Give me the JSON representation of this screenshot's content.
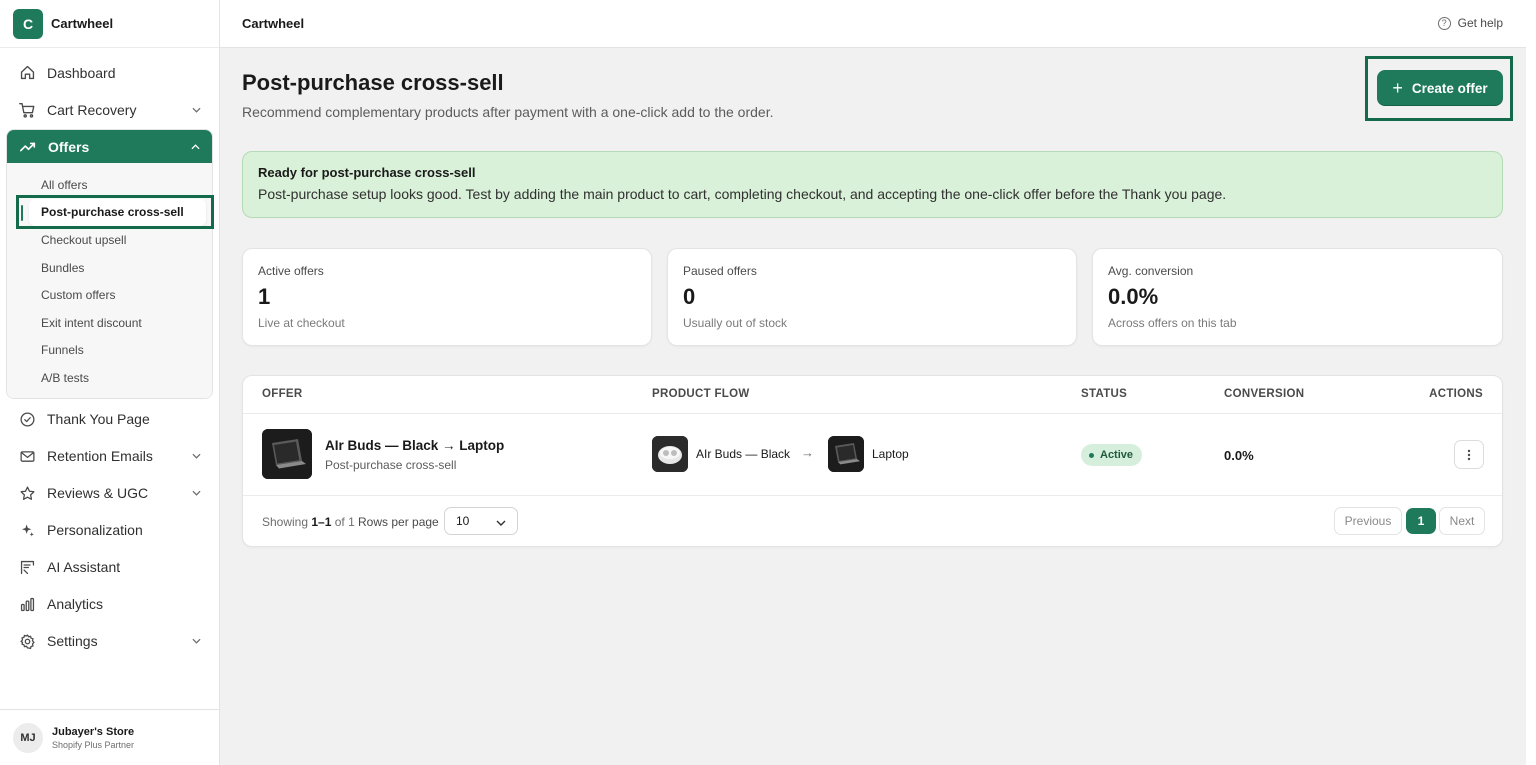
{
  "brand": {
    "logo_letter": "C",
    "name": "Cartwheel",
    "accent": "#1f7a5c"
  },
  "sidebar": {
    "items_top": [
      {
        "label": "Dashboard",
        "icon": "home-icon"
      },
      {
        "label": "Cart Recovery",
        "icon": "cart-icon",
        "chevron": true
      }
    ],
    "offers": {
      "label": "Offers",
      "icon": "trend-icon",
      "sub": [
        "All offers",
        "Post-purchase cross-sell",
        "Checkout upsell",
        "Bundles",
        "Custom offers",
        "Exit intent discount",
        "Funnels",
        "A/B tests"
      ],
      "current_index": 1
    },
    "items_bottom": [
      {
        "label": "Thank You Page",
        "icon": "check-circle-icon"
      },
      {
        "label": "Retention Emails",
        "icon": "mail-icon",
        "chevron": true
      },
      {
        "label": "Reviews & UGC",
        "icon": "star-icon",
        "chevron": true
      },
      {
        "label": "Personalization",
        "icon": "sparkle-icon"
      },
      {
        "label": "AI Assistant",
        "icon": "ai-icon"
      },
      {
        "label": "Analytics",
        "icon": "bar-chart-icon"
      },
      {
        "label": "Settings",
        "icon": "gear-icon",
        "chevron": true
      }
    ],
    "store": {
      "initials": "MJ",
      "name": "Jubayer's Store",
      "plan": "Shopify Plus Partner"
    }
  },
  "topbar": {
    "title": "Cartwheel",
    "help": "Get help"
  },
  "page": {
    "title": "Post-purchase cross-sell",
    "subtitle": "Recommend complementary products after payment with a one-click add to the order.",
    "create_label": "Create offer"
  },
  "banner": {
    "title": "Ready for post-purchase cross-sell",
    "text": "Post-purchase setup looks good. Test by adding the main product to cart, completing checkout, and accepting the one-click offer before the Thank you page."
  },
  "stats": [
    {
      "label": "Active offers",
      "value": "1",
      "note": "Live at checkout"
    },
    {
      "label": "Paused offers",
      "value": "0",
      "note": "Usually out of stock"
    },
    {
      "label": "Avg. conversion",
      "value": "0.0%",
      "note": "Across offers on this tab"
    }
  ],
  "table": {
    "headers": {
      "offer": "OFFER",
      "flow": "PRODUCT FLOW",
      "status": "STATUS",
      "conversion": "CONVERSION",
      "actions": "ACTIONS"
    },
    "rows": [
      {
        "name": "AIr Buds — Black → Laptop",
        "type": "Post-purchase cross-sell",
        "from_product": "AIr Buds — Black",
        "arrow": "→",
        "to_product": "Laptop",
        "status": "Active",
        "conversion": "0.0%"
      }
    ],
    "footer": {
      "showing_prefix": "Showing",
      "range": "1–1",
      "of_text": "of 1",
      "rows_label": "Rows per page",
      "rows_value": "10",
      "prev": "Previous",
      "page": "1",
      "next": "Next"
    }
  }
}
